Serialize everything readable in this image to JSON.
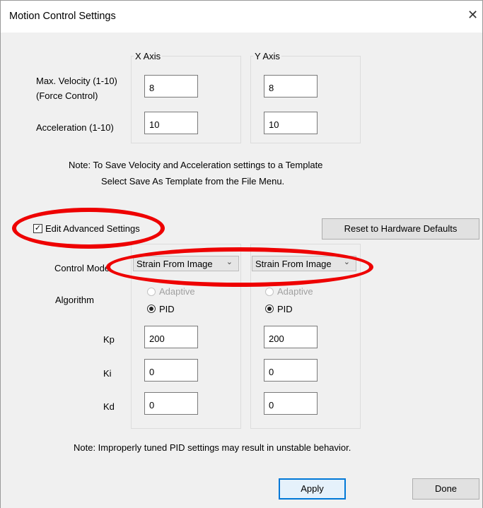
{
  "window": {
    "title": "Motion Control Settings",
    "close_glyph": "✕"
  },
  "axes": {
    "x_title": "X Axis",
    "y_title": "Y Axis"
  },
  "labels": {
    "max_velocity_line1": "Max. Velocity (1-10)",
    "max_velocity_line2": "(Force Control)",
    "acceleration": "Acceleration (1-10)",
    "control_mode": "Control Mode",
    "algorithm": "Algorithm",
    "kp": "Kp",
    "ki": "Ki",
    "kd": "Kd"
  },
  "values": {
    "x": {
      "max_velocity": "8",
      "acceleration": "10",
      "kp": "200",
      "ki": "0",
      "kd": "0",
      "control_mode": "Strain From Image"
    },
    "y": {
      "max_velocity": "8",
      "acceleration": "10",
      "kp": "200",
      "ki": "0",
      "kd": "0",
      "control_mode": "Strain From Image"
    }
  },
  "algorithm_options": {
    "adaptive": "Adaptive",
    "pid": "PID",
    "selected": "PID"
  },
  "notes": {
    "save_line1": "Note:  To Save Velocity and Acceleration settings to a Template",
    "save_line2": "Select Save As Template from the File Menu.",
    "pid_warning": "Note:  Improperly tuned PID settings may result in unstable behavior."
  },
  "advanced": {
    "checkbox_label": "Edit Advanced Settings",
    "checked": true,
    "check_glyph": "✓"
  },
  "buttons": {
    "reset": "Reset to Hardware Defaults",
    "apply": "Apply",
    "done": "Done"
  },
  "icons": {
    "close": "close-icon",
    "chevron": "chevron-down-icon",
    "check": "check-icon"
  },
  "colors": {
    "annotation_red": "#ee0000",
    "default_button_border": "#0078d7"
  }
}
